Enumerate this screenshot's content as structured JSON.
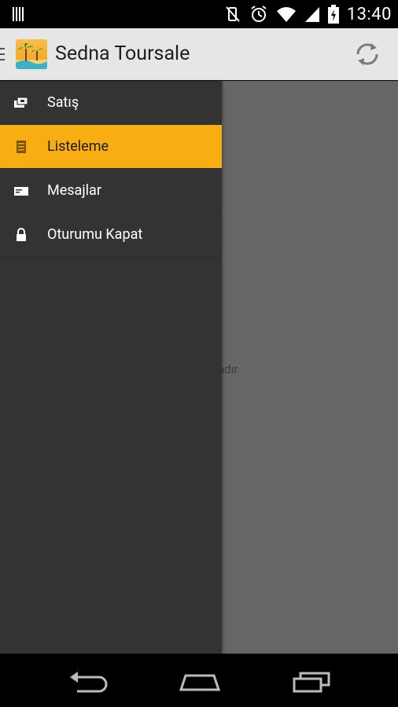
{
  "status_bar": {
    "time": "13:40"
  },
  "app": {
    "title": "Sedna Toursale"
  },
  "drawer": {
    "items": [
      {
        "label": "Satış",
        "icon": "cash-icon",
        "selected": false
      },
      {
        "label": "Listeleme",
        "icon": "list-icon",
        "selected": true
      },
      {
        "label": "Mesajlar",
        "icon": "message-icon",
        "selected": false
      },
      {
        "label": "Oturumu Kapat",
        "icon": "lock-icon",
        "selected": false
      }
    ]
  },
  "content": {
    "message": "...mamaktadır"
  },
  "colors": {
    "accent": "#f8ae13",
    "drawer_bg": "#333333",
    "action_bar": "#e6e6e6",
    "content_bg": "#666666"
  }
}
